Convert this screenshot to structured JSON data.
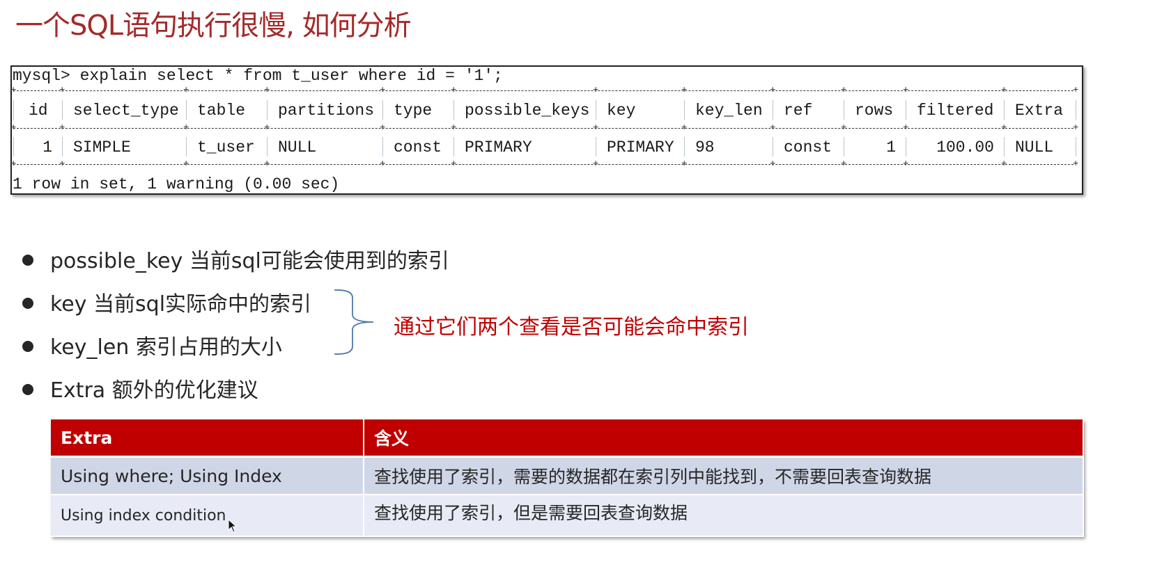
{
  "slide": {
    "title": "一个SQL语句执行很慢, 如何分析"
  },
  "terminal": {
    "command": "mysql> explain select * from t_user where id = '1';",
    "columns": [
      "id",
      "select_type",
      "table",
      "partitions",
      "type",
      "possible_keys",
      "key",
      "key_len",
      "ref",
      "rows",
      "filtered",
      "Extra"
    ],
    "rows": [
      [
        "1",
        "SIMPLE",
        "t_user",
        "NULL",
        "const",
        "PRIMARY",
        "PRIMARY",
        "98",
        "const",
        "1",
        "100.00",
        "NULL"
      ]
    ],
    "status": "1 row in set, 1 warning (0.00 sec)"
  },
  "bullets": [
    {
      "text": "possible_key  当前sql可能会使用到的索引"
    },
    {
      "text": "key 当前sql实际命中的索引"
    },
    {
      "text": "key_len 索引占用的大小"
    },
    {
      "text": "Extra 额外的优化建议"
    }
  ],
  "brace_note": "通过它们两个查看是否可能会命中索引",
  "extra_table": {
    "headers": [
      "Extra",
      "含义"
    ],
    "rows": [
      {
        "extra": "Using where; Using Index",
        "meaning": "查找使用了索引，需要的数据都在索引列中能找到，不需要回表查询数据"
      },
      {
        "extra": "Using index condition",
        "meaning": "查找使用了索引，但是需要回表查询数据"
      }
    ]
  },
  "colors": {
    "title": "#a42a2a",
    "note": "#c00000",
    "table_header": "#c00000",
    "row_odd": "#cfd7e7",
    "row_even": "#e8ebf5",
    "brace": "#4a78b0"
  }
}
